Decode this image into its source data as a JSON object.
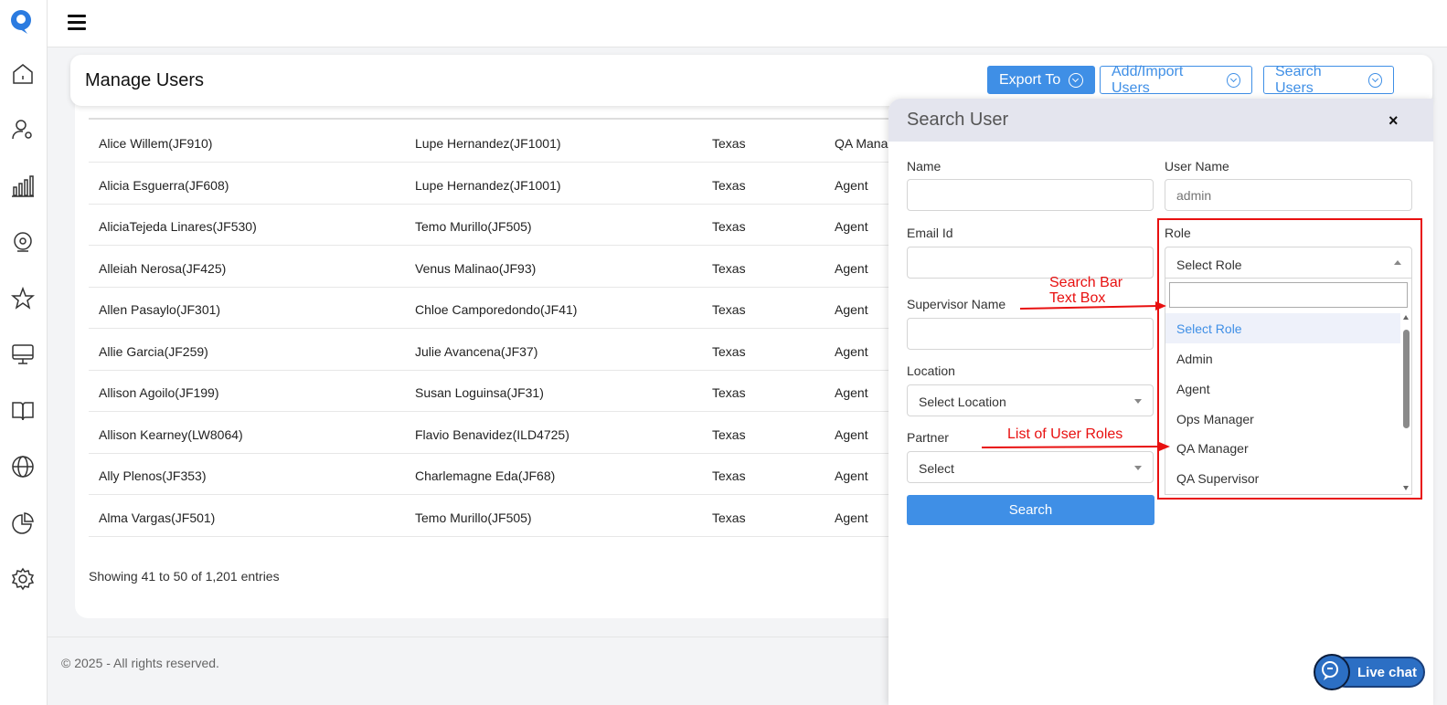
{
  "header": {
    "title": "Manage Users",
    "export_label": "Export To",
    "add_label": "Add/Import Users",
    "search_label": "Search Users"
  },
  "table": {
    "rows": [
      {
        "name": "Alice Willem(JF910)",
        "supervisor": "Lupe Hernandez(JF1001)",
        "location": "Texas",
        "role": "QA Mana"
      },
      {
        "name": "Alicia Esguerra(JF608)",
        "supervisor": "Lupe Hernandez(JF1001)",
        "location": "Texas",
        "role": "Agent"
      },
      {
        "name": "AliciaTejeda Linares(JF530)",
        "supervisor": "Temo Murillo(JF505)",
        "location": "Texas",
        "role": "Agent"
      },
      {
        "name": "Alleiah Nerosa(JF425)",
        "supervisor": "Venus Malinao(JF93)",
        "location": "Texas",
        "role": "Agent"
      },
      {
        "name": "Allen Pasaylo(JF301)",
        "supervisor": "Chloe Camporedondo(JF41)",
        "location": "Texas",
        "role": "Agent"
      },
      {
        "name": "Allie Garcia(JF259)",
        "supervisor": "Julie Avancena(JF37)",
        "location": "Texas",
        "role": "Agent"
      },
      {
        "name": "Allison Agoilo(JF199)",
        "supervisor": "Susan Loguinsa(JF31)",
        "location": "Texas",
        "role": "Agent"
      },
      {
        "name": "Allison Kearney(LW8064)",
        "supervisor": "Flavio Benavidez(ILD4725)",
        "location": "Texas",
        "role": "Agent"
      },
      {
        "name": "Ally Plenos(JF353)",
        "supervisor": "Charlemagne Eda(JF68)",
        "location": "Texas",
        "role": "Agent"
      },
      {
        "name": "Alma Vargas(JF501)",
        "supervisor": "Temo Murillo(JF505)",
        "location": "Texas",
        "role": "Agent"
      }
    ],
    "entries_text": "Showing 41 to 50 of 1,201 entries"
  },
  "footer": {
    "copyright": "© 2025 - All rights reserved."
  },
  "search_panel": {
    "title": "Search User",
    "close": "×",
    "name_label": "Name",
    "username_label": "User Name",
    "username_placeholder": "admin",
    "email_label": "Email Id",
    "role_label": "Role",
    "role_selected": "Select Role",
    "supervisor_label": "Supervisor Name",
    "location_label": "Location",
    "location_selected": "Select Location",
    "partner_label": "Partner",
    "partner_selected": "Select",
    "search_button": "Search",
    "role_options": [
      "Select Role",
      "Admin",
      "Agent",
      "Ops Manager",
      "QA Manager",
      "QA Supervisor"
    ]
  },
  "annotations": {
    "search_bar_line1": "Search Bar",
    "search_bar_line2": "Text Box",
    "list_roles": "List of User Roles",
    "color": "#e81010"
  },
  "livechat": {
    "label": "Live chat"
  },
  "colors": {
    "accent": "#3f8fe6",
    "annotation": "#e81010"
  },
  "icons": [
    "app-logo-icon",
    "home-icon",
    "user-settings-icon",
    "bar-chart-icon",
    "support-icon",
    "star-icon",
    "monitor-icon",
    "book-icon",
    "globe-icon",
    "pie-chart-icon",
    "gear-icon"
  ]
}
